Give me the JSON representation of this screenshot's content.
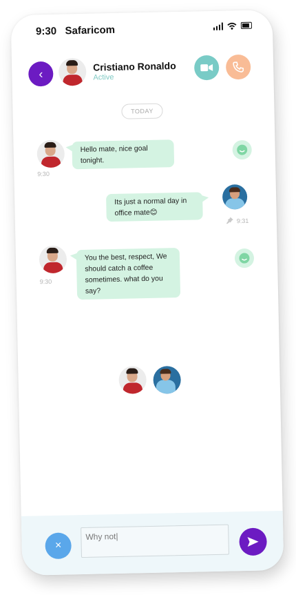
{
  "status_bar": {
    "time": "9:30",
    "carrier": "Safaricom"
  },
  "header": {
    "back_label": "‹",
    "contact_name": "Cristiano Ronaldo",
    "contact_status": "Active"
  },
  "chat": {
    "day_separator": "TODAY",
    "messages": [
      {
        "sender": "contact",
        "text": "Hello mate, nice goal tonight.",
        "time": "9:30"
      },
      {
        "sender": "me",
        "text": "Its just a normal day in office mate😊",
        "time": "9:31"
      },
      {
        "sender": "contact",
        "text": "You the best, respect,  We should catch a coffee sometimes. what do you say?",
        "time": "9:30"
      }
    ]
  },
  "composer": {
    "close_label": "×",
    "input_value": "Why not|",
    "placeholder": ""
  },
  "colors": {
    "accent": "#6c1bc2",
    "bubble": "#d4f3e2",
    "video": "#79cbc6",
    "call": "#f9bc96",
    "close": "#5aa7ea"
  }
}
